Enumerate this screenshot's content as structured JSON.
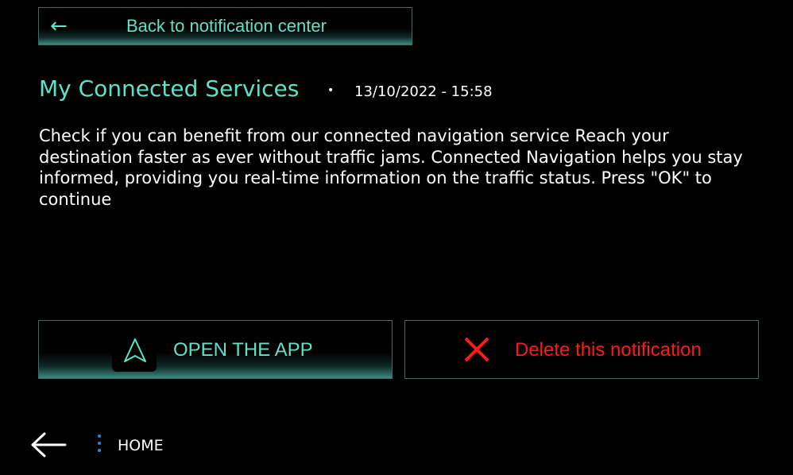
{
  "header": {
    "back_arrow": "←",
    "back_label": "Back to notification center"
  },
  "notification": {
    "title": "My Connected Services",
    "separator": "•",
    "timestamp": "13/10/2022 - 15:58",
    "message": "Check if you can benefit from our connected navigation service Reach your destination faster as ever without traffic jams. Connected Navigation helps you stay informed, providing you real-time information on the traffic status. Press \"OK\" to continue"
  },
  "actions": {
    "open_app_label": "OPEN THE APP",
    "open_app_icon": "navigation-arrow-icon",
    "delete_label": "Delete this notification",
    "delete_icon": "close-x-icon"
  },
  "footer": {
    "home_label": "HOME",
    "back_icon": "back-arrow-icon",
    "menu_icon": "vertical-dots-icon"
  },
  "colors": {
    "accent": "#5ee3c9",
    "danger": "#ff1a1a",
    "border": "#3a6e66",
    "dots": "#1e88e5",
    "background": "#000000"
  }
}
